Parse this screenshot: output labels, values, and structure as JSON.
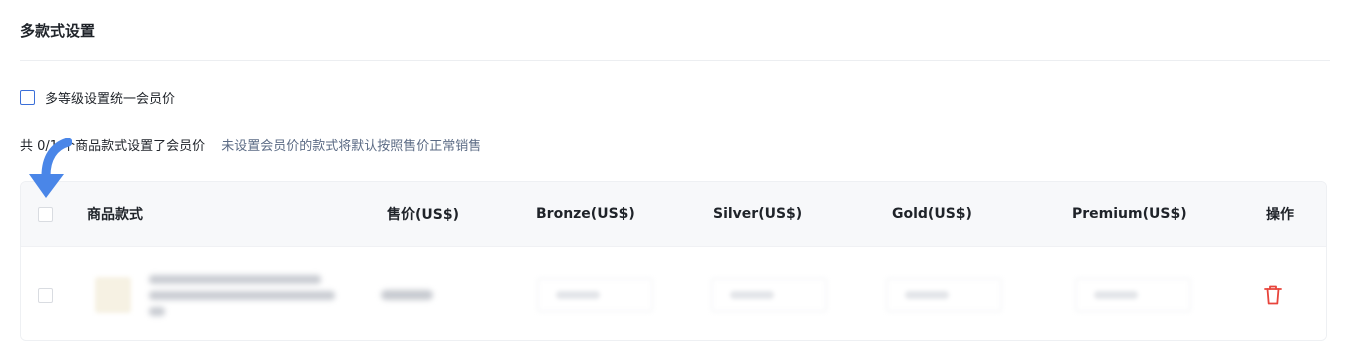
{
  "section": {
    "title": "多款式设置"
  },
  "unify": {
    "checked": false,
    "label": "多等级设置统一会员价"
  },
  "summary": {
    "count_text": "共 0/1 个商品款式设置了会员价",
    "hint_text": "未设置会员价的款式将默认按照售价正常销售"
  },
  "table": {
    "headers": {
      "variant": "商品款式",
      "price": "售价(US$)",
      "bronze": "Bronze(US$)",
      "silver": "Silver(US$)",
      "gold": "Gold(US$)",
      "premium": "Premium(US$)",
      "action": "操作"
    },
    "rows": [
      {
        "checked": false,
        "variant_blurred": true,
        "price_blurred": true,
        "action_icon": "trash-icon"
      }
    ]
  },
  "annotation": {
    "icon": "arrow-down-icon",
    "color": "#4a86e8"
  },
  "colors": {
    "accent": "#3b6fd8",
    "danger": "#e8453c",
    "hint": "#5b6b85"
  }
}
